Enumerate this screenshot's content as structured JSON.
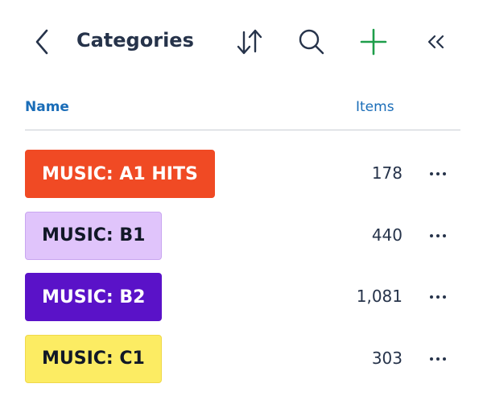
{
  "header": {
    "title": "Categories",
    "icons": {
      "back": "chevron-left-icon",
      "sort": "sort-arrows-icon",
      "search": "search-icon",
      "add": "plus-icon",
      "collapse": "double-chevron-left-icon"
    },
    "add_color": "#1e9e4a"
  },
  "table": {
    "columns": {
      "name": "Name",
      "items": "Items"
    },
    "rows": [
      {
        "label": "MUSIC: A1 HITS",
        "count": "178",
        "bg": "#f04a24",
        "fg": "#ffffff",
        "border": "#f04a24"
      },
      {
        "label": "MUSIC: B1",
        "count": "440",
        "bg": "#e0c4fb",
        "fg": "#111827",
        "border": "#c9a6f0"
      },
      {
        "label": "MUSIC: B2",
        "count": "1,081",
        "bg": "#5a12c8",
        "fg": "#ffffff",
        "border": "#5a12c8"
      },
      {
        "label": "MUSIC: C1",
        "count": "303",
        "bg": "#fcec63",
        "fg": "#111827",
        "border": "#f0d84a"
      }
    ]
  }
}
